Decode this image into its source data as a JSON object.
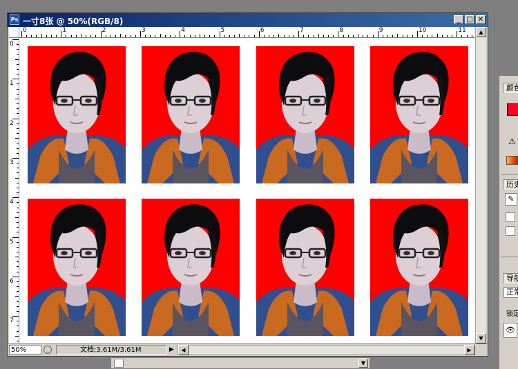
{
  "document": {
    "title": "一寸8张 @ 50%(RGB/8)",
    "app_icon": "Ps",
    "window_buttons": {
      "minimize": "_",
      "maximize": "□",
      "close": "✕"
    }
  },
  "ruler": {
    "horizontal_labels": [
      "0",
      "1",
      "2",
      "3",
      "4",
      "5",
      "6",
      "7",
      "8",
      "9",
      "10",
      "11"
    ],
    "vertical_labels": [
      "0",
      "1",
      "2",
      "3",
      "4",
      "5",
      "6",
      "7"
    ]
  },
  "canvas": {
    "photo_count": 8,
    "photo_background": "#ff0000",
    "hoodie_color": "#2f4f8f",
    "hood_lining_color": "#c96a20"
  },
  "status": {
    "zoom": "50%",
    "doc_info": "文档:3.61M/3.61M",
    "arrow": "▶"
  },
  "scrollbars": {
    "up": "▲",
    "down": "▼",
    "left": "◀",
    "right": "▶"
  },
  "side_panel": {
    "tabs": [
      "颜色",
      "历史",
      "导航"
    ],
    "mode_field": "正常",
    "lock_label": "锁定",
    "warning_glyph": "⚠",
    "eye_glyph": "👁",
    "brush_glyph": "✎"
  },
  "colors": {
    "titlebar_start": "#0a246a",
    "titlebar_end": "#3a6ea5",
    "foreground_color": "#ff0022",
    "workspace": "#7f7f7f"
  }
}
